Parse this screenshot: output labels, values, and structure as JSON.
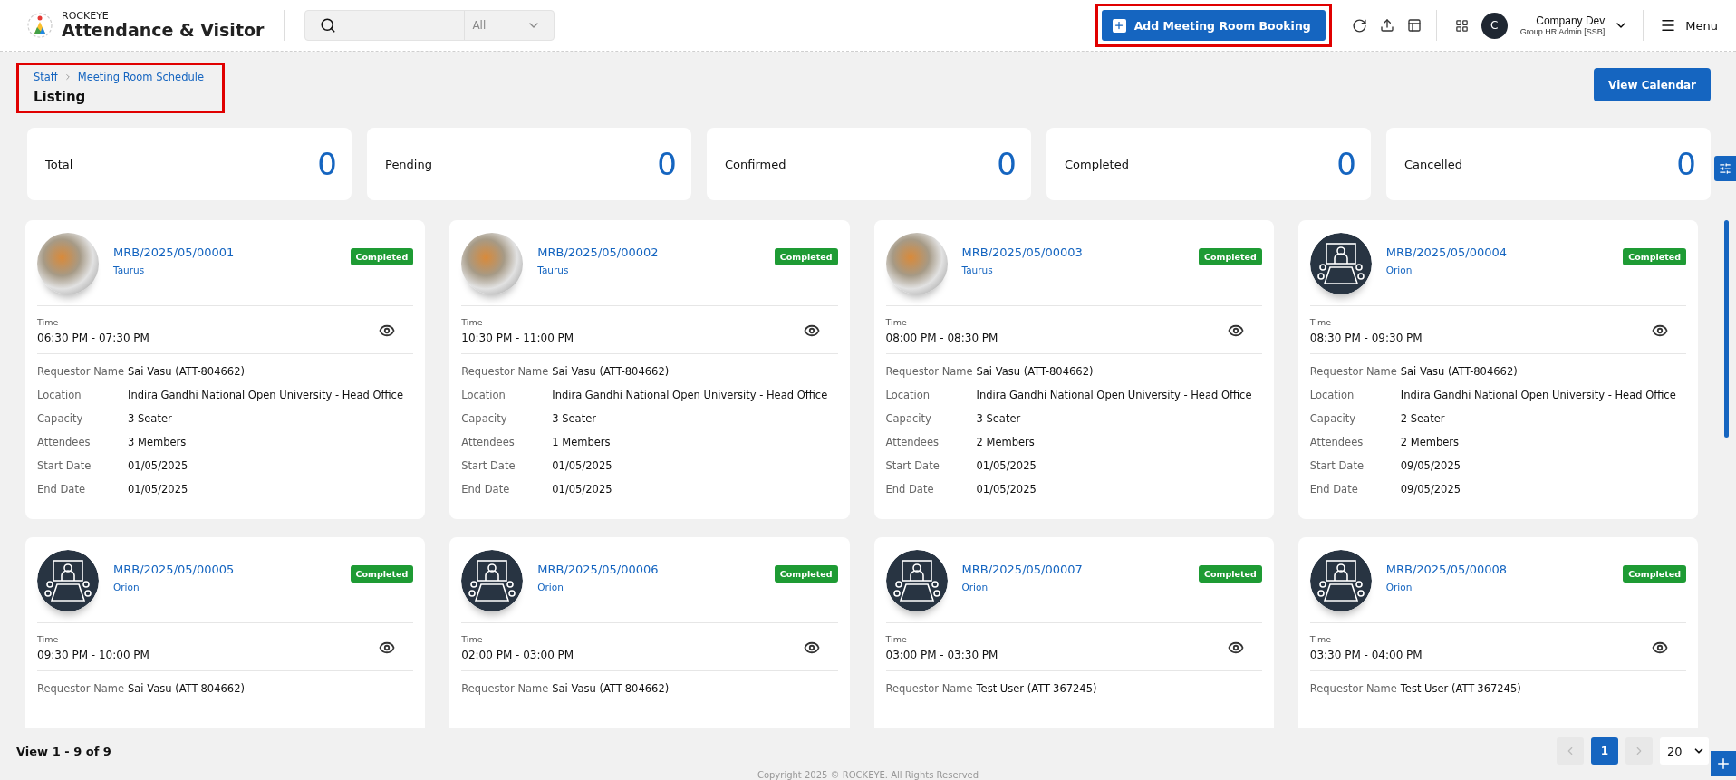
{
  "header": {
    "brand": "ROCKEYE",
    "app_name": "Attendance & Visitor",
    "search": {
      "filter": "All"
    },
    "add_button": {
      "label": "Add Meeting Room Booking",
      "highlighted": true
    },
    "user": {
      "initial": "C",
      "name": "Company Dev",
      "role": "Group HR Admin [SSB]"
    },
    "menu_label": "Menu"
  },
  "breadcrumb": {
    "items": [
      "Staff",
      "Meeting Room Schedule"
    ],
    "title": "Listing",
    "highlighted": true
  },
  "view_calendar": "View Calendar",
  "stats": [
    {
      "label": "Total",
      "value": "0"
    },
    {
      "label": "Pending",
      "value": "0"
    },
    {
      "label": "Confirmed",
      "value": "0"
    },
    {
      "label": "Completed",
      "value": "0"
    },
    {
      "label": "Cancelled",
      "value": "0"
    }
  ],
  "cards": [
    {
      "code": "MRB/2025/05/00001",
      "room": "Taurus",
      "status": "Completed",
      "kind": "photo",
      "time_label": "Time",
      "time": "06:30 PM - 07:30 PM",
      "details": [
        {
          "label": "Requestor Name",
          "value": "Sai Vasu (ATT-804662)"
        },
        {
          "label": "Location",
          "value": "Indira Gandhi National Open University - Head Office"
        },
        {
          "label": "Capacity",
          "value": "3 Seater"
        },
        {
          "label": "Attendees",
          "value": "3 Members"
        },
        {
          "label": "Start Date",
          "value": "01/05/2025"
        },
        {
          "label": "End Date",
          "value": "01/05/2025"
        }
      ]
    },
    {
      "code": "MRB/2025/05/00002",
      "room": "Taurus",
      "status": "Completed",
      "kind": "photo",
      "time_label": "Time",
      "time": "10:30 PM - 11:00 PM",
      "details": [
        {
          "label": "Requestor Name",
          "value": "Sai Vasu (ATT-804662)"
        },
        {
          "label": "Location",
          "value": "Indira Gandhi National Open University - Head Office"
        },
        {
          "label": "Capacity",
          "value": "3 Seater"
        },
        {
          "label": "Attendees",
          "value": "1 Members"
        },
        {
          "label": "Start Date",
          "value": "01/05/2025"
        },
        {
          "label": "End Date",
          "value": "01/05/2025"
        }
      ]
    },
    {
      "code": "MRB/2025/05/00003",
      "room": "Taurus",
      "status": "Completed",
      "kind": "photo",
      "time_label": "Time",
      "time": "08:00 PM - 08:30 PM",
      "details": [
        {
          "label": "Requestor Name",
          "value": "Sai Vasu (ATT-804662)"
        },
        {
          "label": "Location",
          "value": "Indira Gandhi National Open University - Head Office"
        },
        {
          "label": "Capacity",
          "value": "3 Seater"
        },
        {
          "label": "Attendees",
          "value": "2 Members"
        },
        {
          "label": "Start Date",
          "value": "01/05/2025"
        },
        {
          "label": "End Date",
          "value": "01/05/2025"
        }
      ]
    },
    {
      "code": "MRB/2025/05/00004",
      "room": "Orion",
      "status": "Completed",
      "kind": "illustration",
      "time_label": "Time",
      "time": "08:30 PM - 09:30 PM",
      "details": [
        {
          "label": "Requestor Name",
          "value": "Sai Vasu (ATT-804662)"
        },
        {
          "label": "Location",
          "value": "Indira Gandhi National Open University - Head Office"
        },
        {
          "label": "Capacity",
          "value": "2 Seater"
        },
        {
          "label": "Attendees",
          "value": "2 Members"
        },
        {
          "label": "Start Date",
          "value": "09/05/2025"
        },
        {
          "label": "End Date",
          "value": "09/05/2025"
        }
      ]
    },
    {
      "code": "MRB/2025/05/00005",
      "room": "Orion",
      "status": "Completed",
      "kind": "illustration",
      "time_label": "Time",
      "time": "09:30 PM - 10:00 PM",
      "details": [
        {
          "label": "Requestor Name",
          "value": "Sai Vasu (ATT-804662)"
        }
      ]
    },
    {
      "code": "MRB/2025/05/00006",
      "room": "Orion",
      "status": "Completed",
      "kind": "illustration",
      "time_label": "Time",
      "time": "02:00 PM - 03:00 PM",
      "details": [
        {
          "label": "Requestor Name",
          "value": "Sai Vasu (ATT-804662)"
        }
      ]
    },
    {
      "code": "MRB/2025/05/00007",
      "room": "Orion",
      "status": "Completed",
      "kind": "illustration",
      "time_label": "Time",
      "time": "03:00 PM - 03:30 PM",
      "details": [
        {
          "label": "Requestor Name",
          "value": "Test User (ATT-367245)"
        }
      ]
    },
    {
      "code": "MRB/2025/05/00008",
      "room": "Orion",
      "status": "Completed",
      "kind": "illustration",
      "time_label": "Time",
      "time": "03:30 PM - 04:00 PM",
      "details": [
        {
          "label": "Requestor Name",
          "value": "Test User (ATT-367245)"
        }
      ]
    }
  ],
  "footer": {
    "summary": "View 1 - 9 of 9",
    "pages": [
      {
        "label": "1",
        "selected": true
      }
    ],
    "page_size": "20",
    "copyright": "Copyright 2025 © ROCKEYE. All Rights Reserved"
  }
}
